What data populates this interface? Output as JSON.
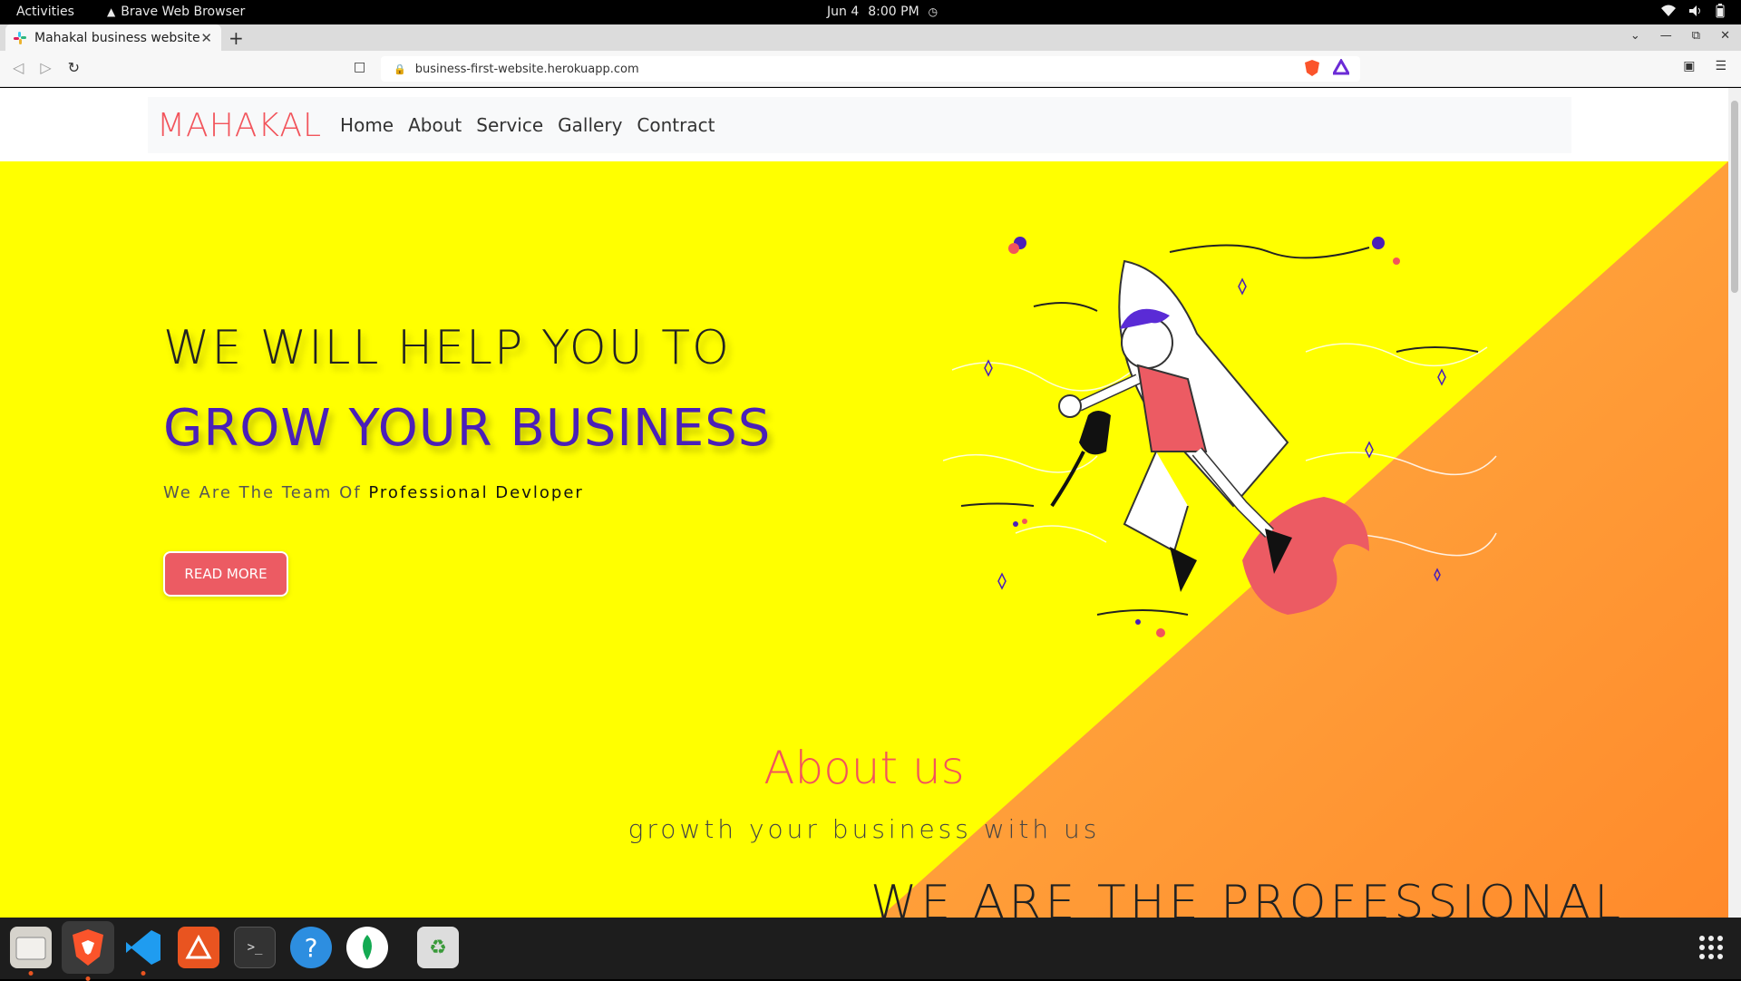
{
  "system_bar": {
    "activities": "Activities",
    "app_name": "Brave Web Browser",
    "date": "Jun 4",
    "time": "8:00 PM"
  },
  "browser": {
    "tab_title": "Mahakal business website",
    "url": "business-first-website.herokuapp.com"
  },
  "site": {
    "brand": "MAHAKAL",
    "nav": [
      "Home",
      "About",
      "Service",
      "Gallery",
      "Contract"
    ],
    "hero": {
      "line1": "WE WILL HELP YOU TO",
      "line2": "GROW YOUR BUSINESS",
      "sub_prefix": "We Are The Team Of",
      "sub_strong": "Professional Devloper",
      "button": "READ MORE"
    },
    "about": {
      "title": "About us",
      "subtitle": "growth your business with us",
      "heading": "WE ARE THE PROFESSIONAL"
    }
  },
  "colors": {
    "brand": "#f2545b",
    "hero_bg": "#ffff00",
    "accent_purple": "#4a1fb8",
    "orange": "#ffa733"
  },
  "dock": [
    "files-icon",
    "brave-icon",
    "vscode-icon",
    "software-center-icon",
    "terminal-icon",
    "help-icon",
    "mongodb-compass-icon",
    "trash-icon",
    "app-grid-icon"
  ]
}
